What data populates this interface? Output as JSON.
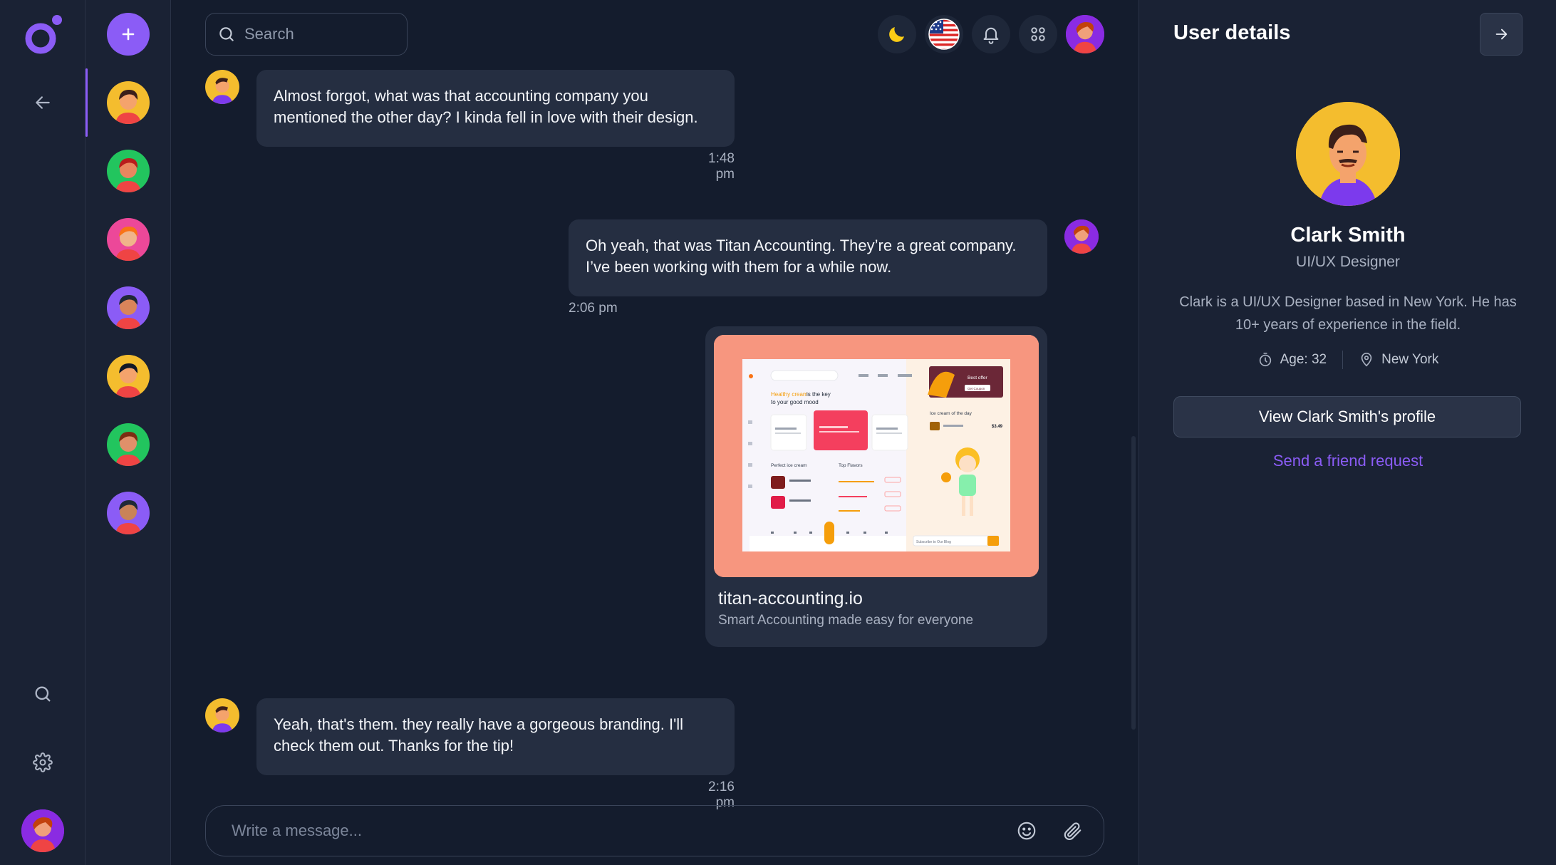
{
  "colors": {
    "accent": "#8b5cf6",
    "background": "#141c2d",
    "panel": "#1a2234",
    "bubble": "#252e41"
  },
  "rail": {
    "logo_icon": "app-logo",
    "icons": [
      "arrow-left-icon",
      "search-icon",
      "gear-icon"
    ]
  },
  "contacts": {
    "add_icon": "plus-icon",
    "items": [
      {
        "name": "Clark Smith",
        "color": "#f4bd2e"
      },
      {
        "name": "contact-2",
        "color": "#22c55e"
      },
      {
        "name": "contact-3",
        "color": "#ec4899"
      },
      {
        "name": "contact-4",
        "color": "#8b5cf6"
      },
      {
        "name": "contact-5",
        "color": "#f4bd2e"
      },
      {
        "name": "contact-6",
        "color": "#22c55e"
      },
      {
        "name": "contact-7",
        "color": "#8b5cf6"
      }
    ]
  },
  "topbar": {
    "search_placeholder": "Search",
    "icons": [
      "moon-icon",
      "us-flag-icon",
      "bell-icon",
      "apps-grid-icon"
    ]
  },
  "messages": [
    {
      "side": "left",
      "text_line1": "Almost forgot, what was that accounting company you",
      "text_line2": "mentioned the other day? I kinda fell in love with their design.",
      "time": "1:48 pm"
    },
    {
      "side": "right",
      "text_line1": "Oh yeah, that was Titan Accounting. They’re a great company.",
      "text_line2": "I’ve been working with them for a while now.",
      "time": "2:06 pm"
    },
    {
      "side": "left",
      "text_line1": "Yeah, that's them. they really have a gorgeous branding. I'll",
      "text_line2": "check them out. Thanks for the tip!",
      "time": "2:16 pm"
    }
  ],
  "link_preview": {
    "title": "titan-accounting.io",
    "description": "Smart Accounting made easy for everyone",
    "preview_text": {
      "headline_highlight": "Healthy cream",
      "headline_rest": "is the key",
      "headline_line2": "to your good mood",
      "promo_title": "Best offer",
      "promo_button": "Get Coupon",
      "card_title": "Ice cream of the day",
      "card_price": "$3.49",
      "section_left": "Perfect ice cream",
      "section_right": "Top Flavors",
      "subscribe": "Subscribe to Our Blog"
    }
  },
  "composer": {
    "placeholder": "Write a message...",
    "icons": [
      "emoji-icon",
      "paperclip-icon"
    ]
  },
  "details": {
    "title": "User details",
    "name": "Clark Smith",
    "role": "UI/UX Designer",
    "bio": "Clark is a UI/UX Designer based in New York. He has 10+ years of experience in the field.",
    "age": "Age: 32",
    "location": "New York",
    "profile_button": "View Clark Smith's profile",
    "friend_link": "Send a friend request"
  }
}
